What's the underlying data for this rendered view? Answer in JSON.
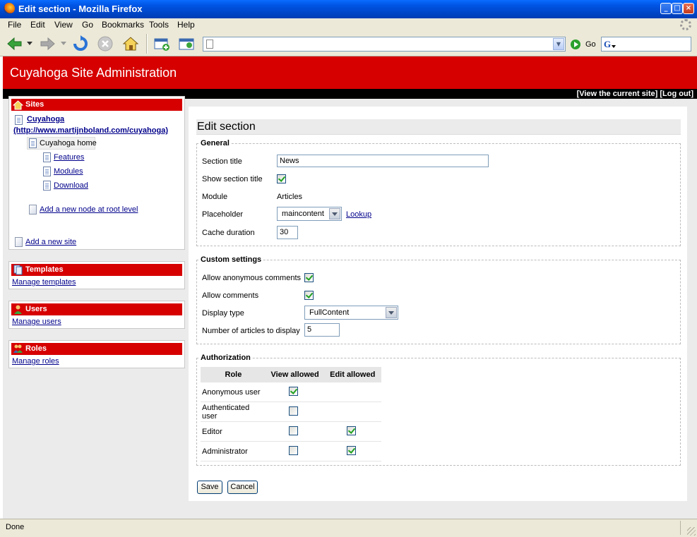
{
  "window": {
    "title": "Edit section - Mozilla Firefox"
  },
  "menu": [
    "File",
    "Edit",
    "View",
    "Go",
    "Bookmarks",
    "Tools",
    "Help"
  ],
  "toolbar": {
    "go_label": "Go",
    "url_value": "",
    "search_engine_icon": "google-icon"
  },
  "site": {
    "title": "Cuyahoga Site Administration",
    "top_links": [
      "[View the current site]",
      "[Log out]"
    ]
  },
  "sidebar": {
    "sites": {
      "header": "Sites",
      "site_name": "Cuyahoga",
      "site_url": "(http://www.martijnboland.com/cuyahoga)",
      "root_node": "Cuyahoga home",
      "children": [
        "Features",
        "Modules",
        "Download"
      ],
      "add_root_node": "Add a new node at root level",
      "add_site": "Add a new site"
    },
    "templates": {
      "header": "Templates",
      "link": "Manage templates"
    },
    "users": {
      "header": "Users",
      "link": "Manage users"
    },
    "roles": {
      "header": "Roles",
      "link": "Manage roles"
    }
  },
  "form": {
    "heading": "Edit section",
    "general": {
      "legend": "General",
      "section_title_label": "Section title",
      "section_title_value": "News",
      "show_title_label": "Show section title",
      "show_title_checked": true,
      "module_label": "Module",
      "module_value": "Articles",
      "placeholder_label": "Placeholder",
      "placeholder_value": "maincontent",
      "lookup_link": "Lookup",
      "cache_label": "Cache duration",
      "cache_value": "30"
    },
    "custom": {
      "legend": "Custom settings",
      "anon_comments_label": "Allow anonymous comments",
      "anon_comments_checked": true,
      "comments_label": "Allow comments",
      "comments_checked": true,
      "display_type_label": "Display type",
      "display_type_value": "FullContent",
      "num_articles_label": "Number of articles to display",
      "num_articles_value": "5"
    },
    "authorization": {
      "legend": "Authorization",
      "columns": [
        "Role",
        "View allowed",
        "Edit allowed"
      ],
      "rows": [
        {
          "role": "Anonymous user",
          "view": true,
          "edit": null
        },
        {
          "role": "Authenticated user",
          "view": false,
          "edit": null
        },
        {
          "role": "Editor",
          "view": false,
          "edit": true
        },
        {
          "role": "Administrator",
          "view": false,
          "edit": true
        }
      ]
    },
    "save_label": "Save",
    "cancel_label": "Cancel"
  },
  "status": {
    "text": "Done"
  },
  "colors": {
    "brand_red": "#d60000",
    "xp_blue": "#0054e3"
  }
}
